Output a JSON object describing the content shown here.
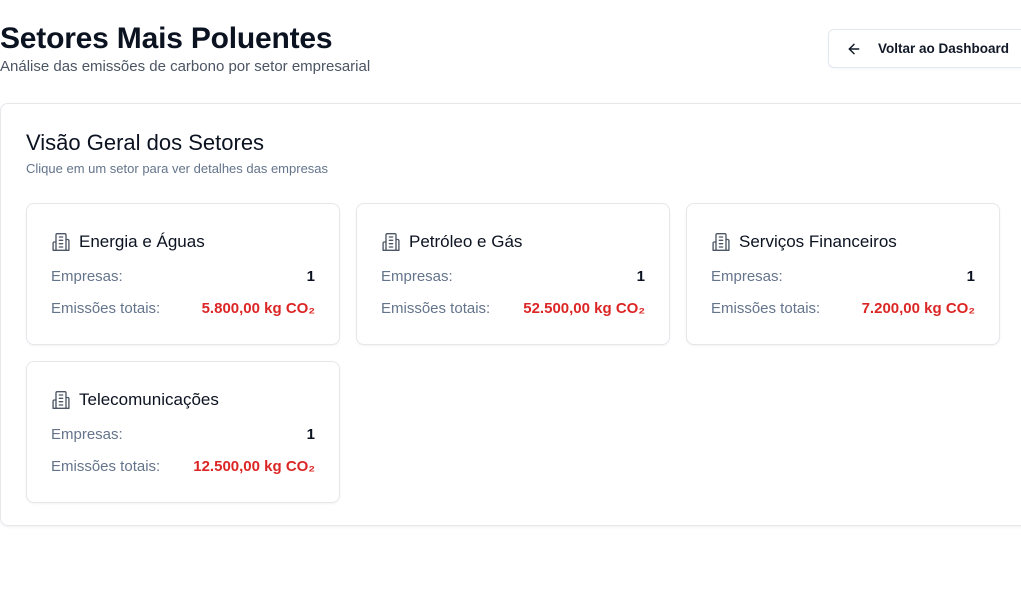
{
  "header": {
    "title": "Setores Mais Poluentes",
    "subtitle": "Análise das emissões de carbono por setor empresarial",
    "back_button_label": "Voltar ao Dashboard",
    "back_icon": "arrow-left-icon"
  },
  "overview": {
    "title": "Visão Geral dos Setores",
    "description": "Clique em um setor para ver detalhes das empresas"
  },
  "sectors": [
    {
      "name": "Energia e Águas",
      "icon": "building-icon",
      "companies_label": "Empresas:",
      "companies": "1",
      "emissions_label": "Emissões totais:",
      "emissions": "5.800,00 kg CO₂"
    },
    {
      "name": "Petróleo e Gás",
      "icon": "building-icon",
      "companies_label": "Empresas:",
      "companies": "1",
      "emissions_label": "Emissões totais:",
      "emissions": "52.500,00 kg CO₂"
    },
    {
      "name": "Serviços Financeiros",
      "icon": "building-icon",
      "companies_label": "Empresas:",
      "companies": "1",
      "emissions_label": "Emissões totais:",
      "emissions": "7.200,00 kg CO₂"
    },
    {
      "name": "Telecomunicações",
      "icon": "building-icon",
      "companies_label": "Empresas:",
      "companies": "1",
      "emissions_label": "Emissões totais:",
      "emissions": "12.500,00 kg CO₂"
    }
  ],
  "colors": {
    "emission_red": "#dc2626",
    "muted_text": "#64748b",
    "border": "#e5e7eb"
  }
}
